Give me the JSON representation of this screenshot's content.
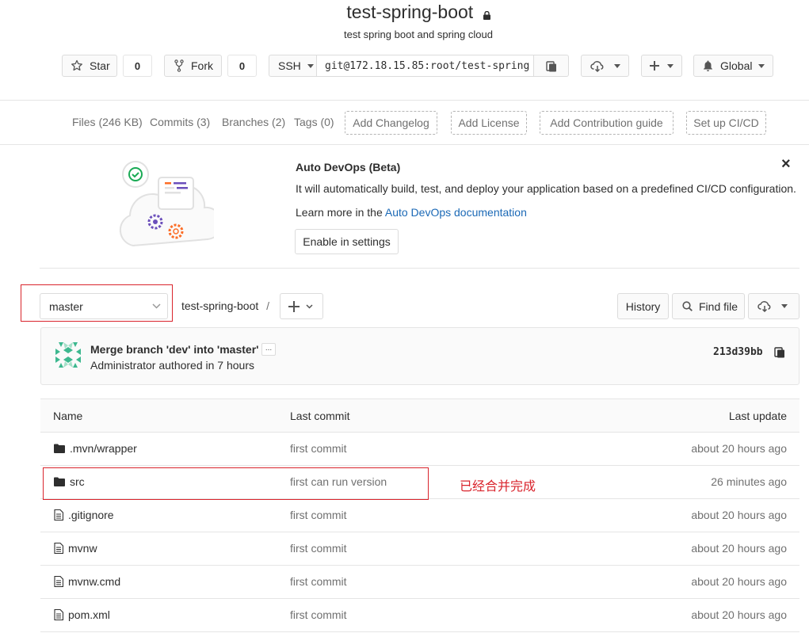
{
  "project": {
    "title": "test-spring-boot",
    "description": "test spring boot and spring cloud"
  },
  "actions": {
    "star_label": "Star",
    "star_count": "0",
    "fork_label": "Fork",
    "fork_count": "0",
    "protocol": "SSH",
    "clone_url": "git@172.18.15.85:root/test-spring",
    "notification_level": "Global"
  },
  "stats_nav": {
    "files": "Files (246 KB)",
    "commits": "Commits (3)",
    "branches": "Branches (2)",
    "tags": "Tags (0)",
    "add_changelog": "Add Changelog",
    "add_license": "Add License",
    "add_contribution_guide": "Add Contribution guide",
    "setup_ci": "Set up CI/CD"
  },
  "devops": {
    "title": "Auto DevOps (Beta)",
    "text": "It will automatically build, test, and deploy your application based on a predefined CI/CD configuration.",
    "learn_more": "Learn more in the",
    "link": "Auto DevOps documentation",
    "enable_button": "Enable in settings",
    "close": "×"
  },
  "tree_nav": {
    "branch": "master",
    "path_root": "test-spring-boot",
    "separator": "/",
    "history": "History",
    "find_file": "Find file"
  },
  "last_commit": {
    "message": "Merge branch 'dev' into 'master'",
    "ellipsis": "...",
    "author_line": "Administrator authored in 7 hours",
    "sha": "213d39bb"
  },
  "table": {
    "headers": {
      "name": "Name",
      "last_commit": "Last commit",
      "last_update": "Last update"
    },
    "rows": [
      {
        "name": ".mvn/wrapper",
        "type": "folder",
        "commit": "first commit",
        "update": "about 20 hours ago"
      },
      {
        "name": "src",
        "type": "folder",
        "commit": "first can run version",
        "update": "26 minutes ago"
      },
      {
        "name": ".gitignore",
        "type": "file",
        "commit": "first commit",
        "update": "about 20 hours ago"
      },
      {
        "name": "mvnw",
        "type": "file",
        "commit": "first commit",
        "update": "about 20 hours ago"
      },
      {
        "name": "mvnw.cmd",
        "type": "file",
        "commit": "first commit",
        "update": "about 20 hours ago"
      },
      {
        "name": "pom.xml",
        "type": "file",
        "commit": "first commit",
        "update": "about 20 hours ago"
      }
    ]
  },
  "annotation": {
    "note": "已经合并完成"
  },
  "colors": {
    "link": "#1b69b6",
    "annotation_red": "#d9242c"
  }
}
